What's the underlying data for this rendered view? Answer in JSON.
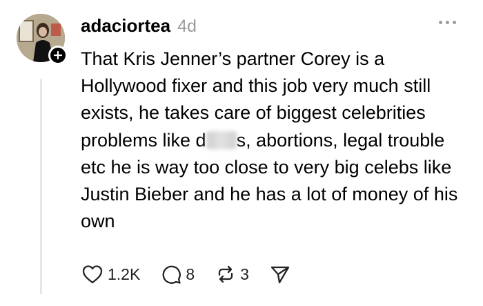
{
  "post": {
    "username": "adaciortea",
    "timestamp": "4d",
    "text_before_redaction": "That Kris Jenner’s partner Corey is a Hollywood fixer and this job very much still exists, he takes care of biggest celebrities problems like d",
    "text_after_redaction": "s, abortions, legal trouble etc he is way too close to very big celebs like Justin Bieber and he has a lot of money of his own"
  },
  "actions": {
    "likes": "1.2K",
    "comments": "8",
    "reposts": "3"
  },
  "icons": {
    "avatar_badge": "plus-icon",
    "more": "more-dots-icon",
    "like": "heart-icon",
    "comment": "speech-bubble-icon",
    "repost": "repost-arrows-icon",
    "share": "send-icon"
  }
}
